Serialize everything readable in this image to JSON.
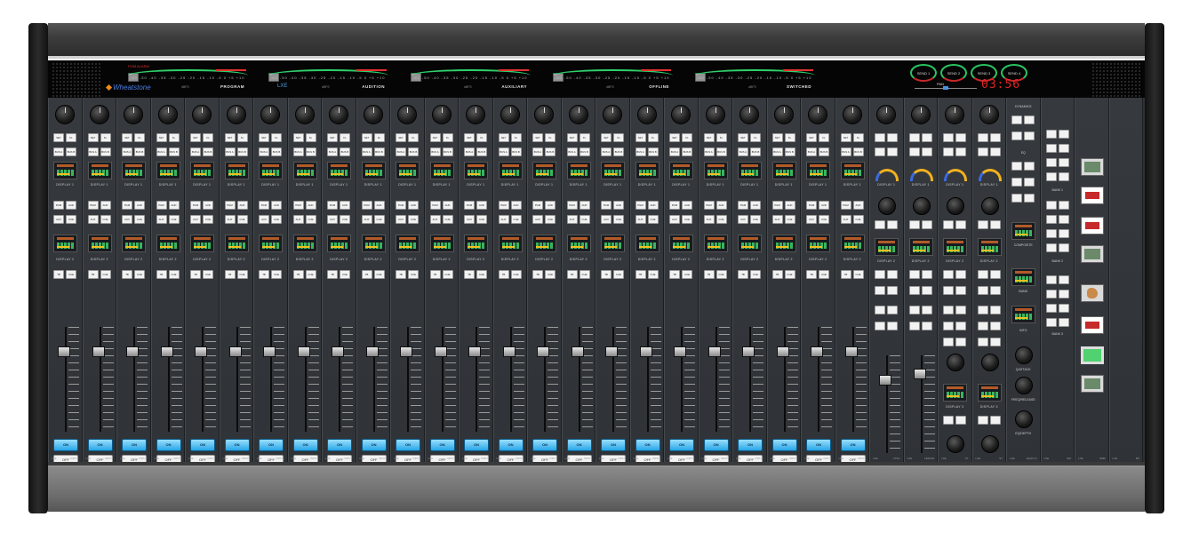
{
  "meter_bridge": {
    "brand": "Wheatstone",
    "model": "LXE",
    "top_warning": "PGM ALARM",
    "meters": [
      {
        "name": "PROGRAM",
        "unit": "dBFS"
      },
      {
        "name": "AUDITION",
        "unit": "dBFS"
      },
      {
        "name": "AUXILIARY",
        "unit": "dBFS"
      },
      {
        "name": "OFFLINE",
        "unit": "dBFS"
      },
      {
        "name": "SWITCHED",
        "unit": "dBFS"
      }
    ],
    "scale": "-60 -50 -40 -35 -30 -25 -20 -15 -10 -5 0 +5 +10 +15 +20",
    "send_knobs": [
      "SEND 1",
      "SEND 2",
      "SEND 3",
      "SEND 4"
    ],
    "pan_label": "PAN",
    "timer": "03:56"
  },
  "input_strip": {
    "buttons_row1": [
      "SET",
      "FL"
    ],
    "buttons_row2": [
      "BUS A",
      "BUS B"
    ],
    "display1_label": "DISPLAY 1",
    "buttons_row3": [
      "PGM",
      "AUD"
    ],
    "buttons_row4": [
      "AUX",
      "CUE"
    ],
    "display2_label": "DISPLAY 2",
    "buttons_row5": [
      "TB",
      "CUE"
    ],
    "on_label": "ON",
    "off_label": "OFF",
    "footer_left": "LXE",
    "footer_right": "INPUT",
    "count": 24
  },
  "special_strips": [
    {
      "footer_left": "LXE",
      "footer_right": "CTRL",
      "display1_label": "DISPLAY 1",
      "display2_label": "DISPLAY 2"
    },
    {
      "footer_left": "LXE",
      "footer_right": "HDPHN",
      "display1_label": "DISPLAY 1",
      "display2_label": "DISPLAY 2"
    },
    {
      "footer_left": "LXE",
      "footer_right": "ST",
      "display1_label": "DISPLAY 1",
      "display2_label": "DISPLAY 2",
      "display3_label": "DISPLAY 3"
    },
    {
      "footer_left": "LXE",
      "footer_right": "ST",
      "display1_label": "DISPLAY 1",
      "display2_label": "DISPLAY 2",
      "display3_label": "DISPLAY 3"
    }
  ],
  "dynamics_strip": {
    "title": "DYNAMICS",
    "eq_label": "EQ",
    "composite_label": "COMPOSITE",
    "band_label": "BAND",
    "info_label": "INFO",
    "knob_labels": [
      "Q/ATTACK",
      "FREQ/RELEASE",
      "EQ/DEPTH"
    ],
    "footer_left": "LXE",
    "footer_right": "EQ/DYN"
  },
  "bank_strip": {
    "bank1": "BANK 1",
    "bank2": "BANK 2",
    "bank3": "BANK 3",
    "footer_left": "LXE",
    "footer_right": "SW"
  },
  "macro_strip": {
    "footer_left": "LXE",
    "footer_right": "SMB"
  },
  "blank_strip": {
    "footer_left": "LXE",
    "footer_right": "BK"
  },
  "colors": {
    "on_button": "#28a6e8",
    "meter_green": "#2fd06a",
    "timer_red": "#e02424"
  }
}
